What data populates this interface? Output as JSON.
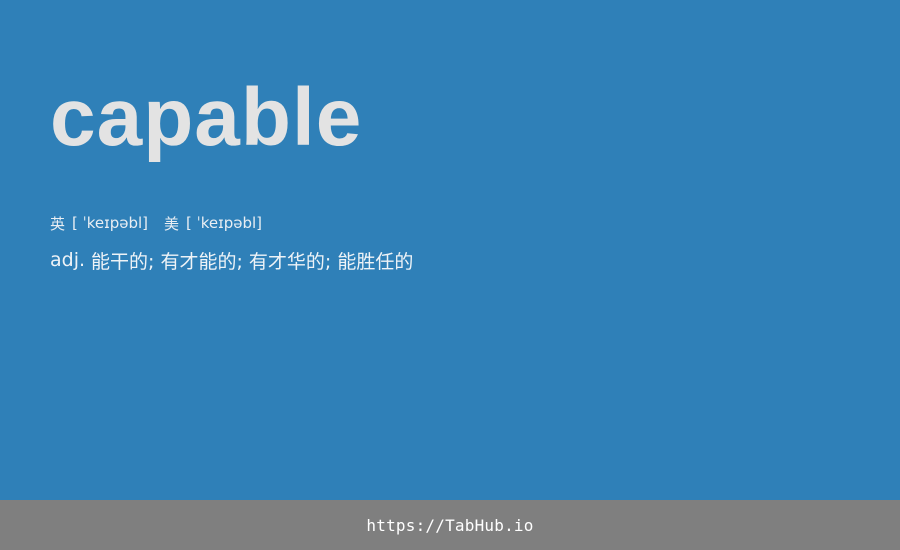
{
  "entry": {
    "word": "capable",
    "phonetics": [
      {
        "region": "英",
        "ipa": "[ ˈkeɪpəbl]"
      },
      {
        "region": "美",
        "ipa": "[ ˈkeɪpəbl]"
      }
    ],
    "definition": {
      "pos": "adj.",
      "meanings": "能干的; 有才能的; 有才华的; 能胜任的"
    }
  },
  "footer": {
    "url": "https://TabHub.io"
  },
  "colors": {
    "background": "#2f80b8",
    "word": "#e3e3e3",
    "footer_background": "#7f7f7f",
    "footer_text": "#ffffff"
  }
}
